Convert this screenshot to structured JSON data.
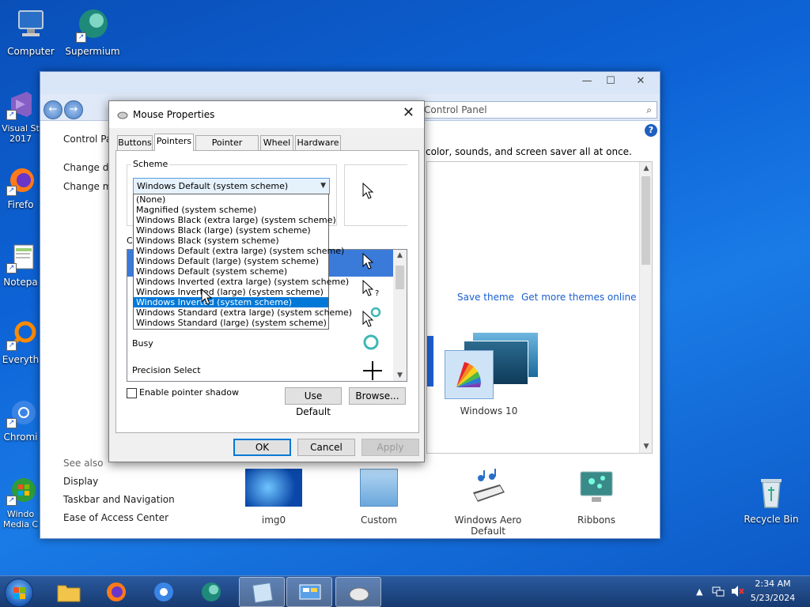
{
  "desktop": {
    "icons": [
      {
        "label": "Computer"
      },
      {
        "label": "Supermium"
      },
      {
        "label": "Visual St 2017"
      },
      {
        "label": "Firefo"
      },
      {
        "label": "Notepa"
      },
      {
        "label": "Everyth"
      },
      {
        "label": "Chromi"
      },
      {
        "label": "Windo Media C"
      },
      {
        "label": "Recycle Bin"
      }
    ]
  },
  "control_panel": {
    "breadcrumb": "Control Panel",
    "left_links": [
      "Control Pan",
      "Change de",
      "Change mo"
    ],
    "description": "color, sounds, and screen saver all at once.",
    "save_theme": "Save theme",
    "get_more_themes": "Get more themes online",
    "theme_label": "Windows 10",
    "see_also": "See also",
    "see_also_links": [
      "Display",
      "Taskbar and Navigation",
      "Ease of Access Center"
    ],
    "bottom_themes": [
      "img0",
      "Custom",
      "Windows Aero Default",
      "Ribbons"
    ]
  },
  "mouse_properties": {
    "title": "Mouse Properties",
    "tabs": [
      "Buttons",
      "Pointers",
      "Pointer Options",
      "Wheel",
      "Hardware"
    ],
    "active_tab": "Pointers",
    "scheme_label": "Scheme",
    "scheme_value": "Windows Default (system scheme)",
    "customize_label": "Cu",
    "cursor_rows": [
      "Busy",
      "Precision Select"
    ],
    "enable_shadow": "Enable pointer shadow",
    "use_default": "Use Default",
    "browse": "Browse...",
    "ok": "OK",
    "cancel": "Cancel",
    "apply": "Apply",
    "dropdown_items": [
      "(None)",
      "Magnified (system scheme)",
      "Windows Black (extra large) (system scheme)",
      "Windows Black (large) (system scheme)",
      "Windows Black (system scheme)",
      "Windows Default (extra large) (system scheme)",
      "Windows Default (large) (system scheme)",
      "Windows Default (system scheme)",
      "Windows Inverted (extra large) (system scheme)",
      "Windows Inverted (large) (system scheme)",
      "Windows Inverted (system scheme)",
      "Windows Standard (extra large) (system scheme)",
      "Windows Standard (large) (system scheme)"
    ],
    "highlighted_item": "Windows Inverted (system scheme)"
  },
  "taskbar": {
    "time": "2:34 AM",
    "date": "5/23/2024"
  },
  "colors": {
    "selection": "#0078d7",
    "accent_link": "#1a5fd0"
  }
}
